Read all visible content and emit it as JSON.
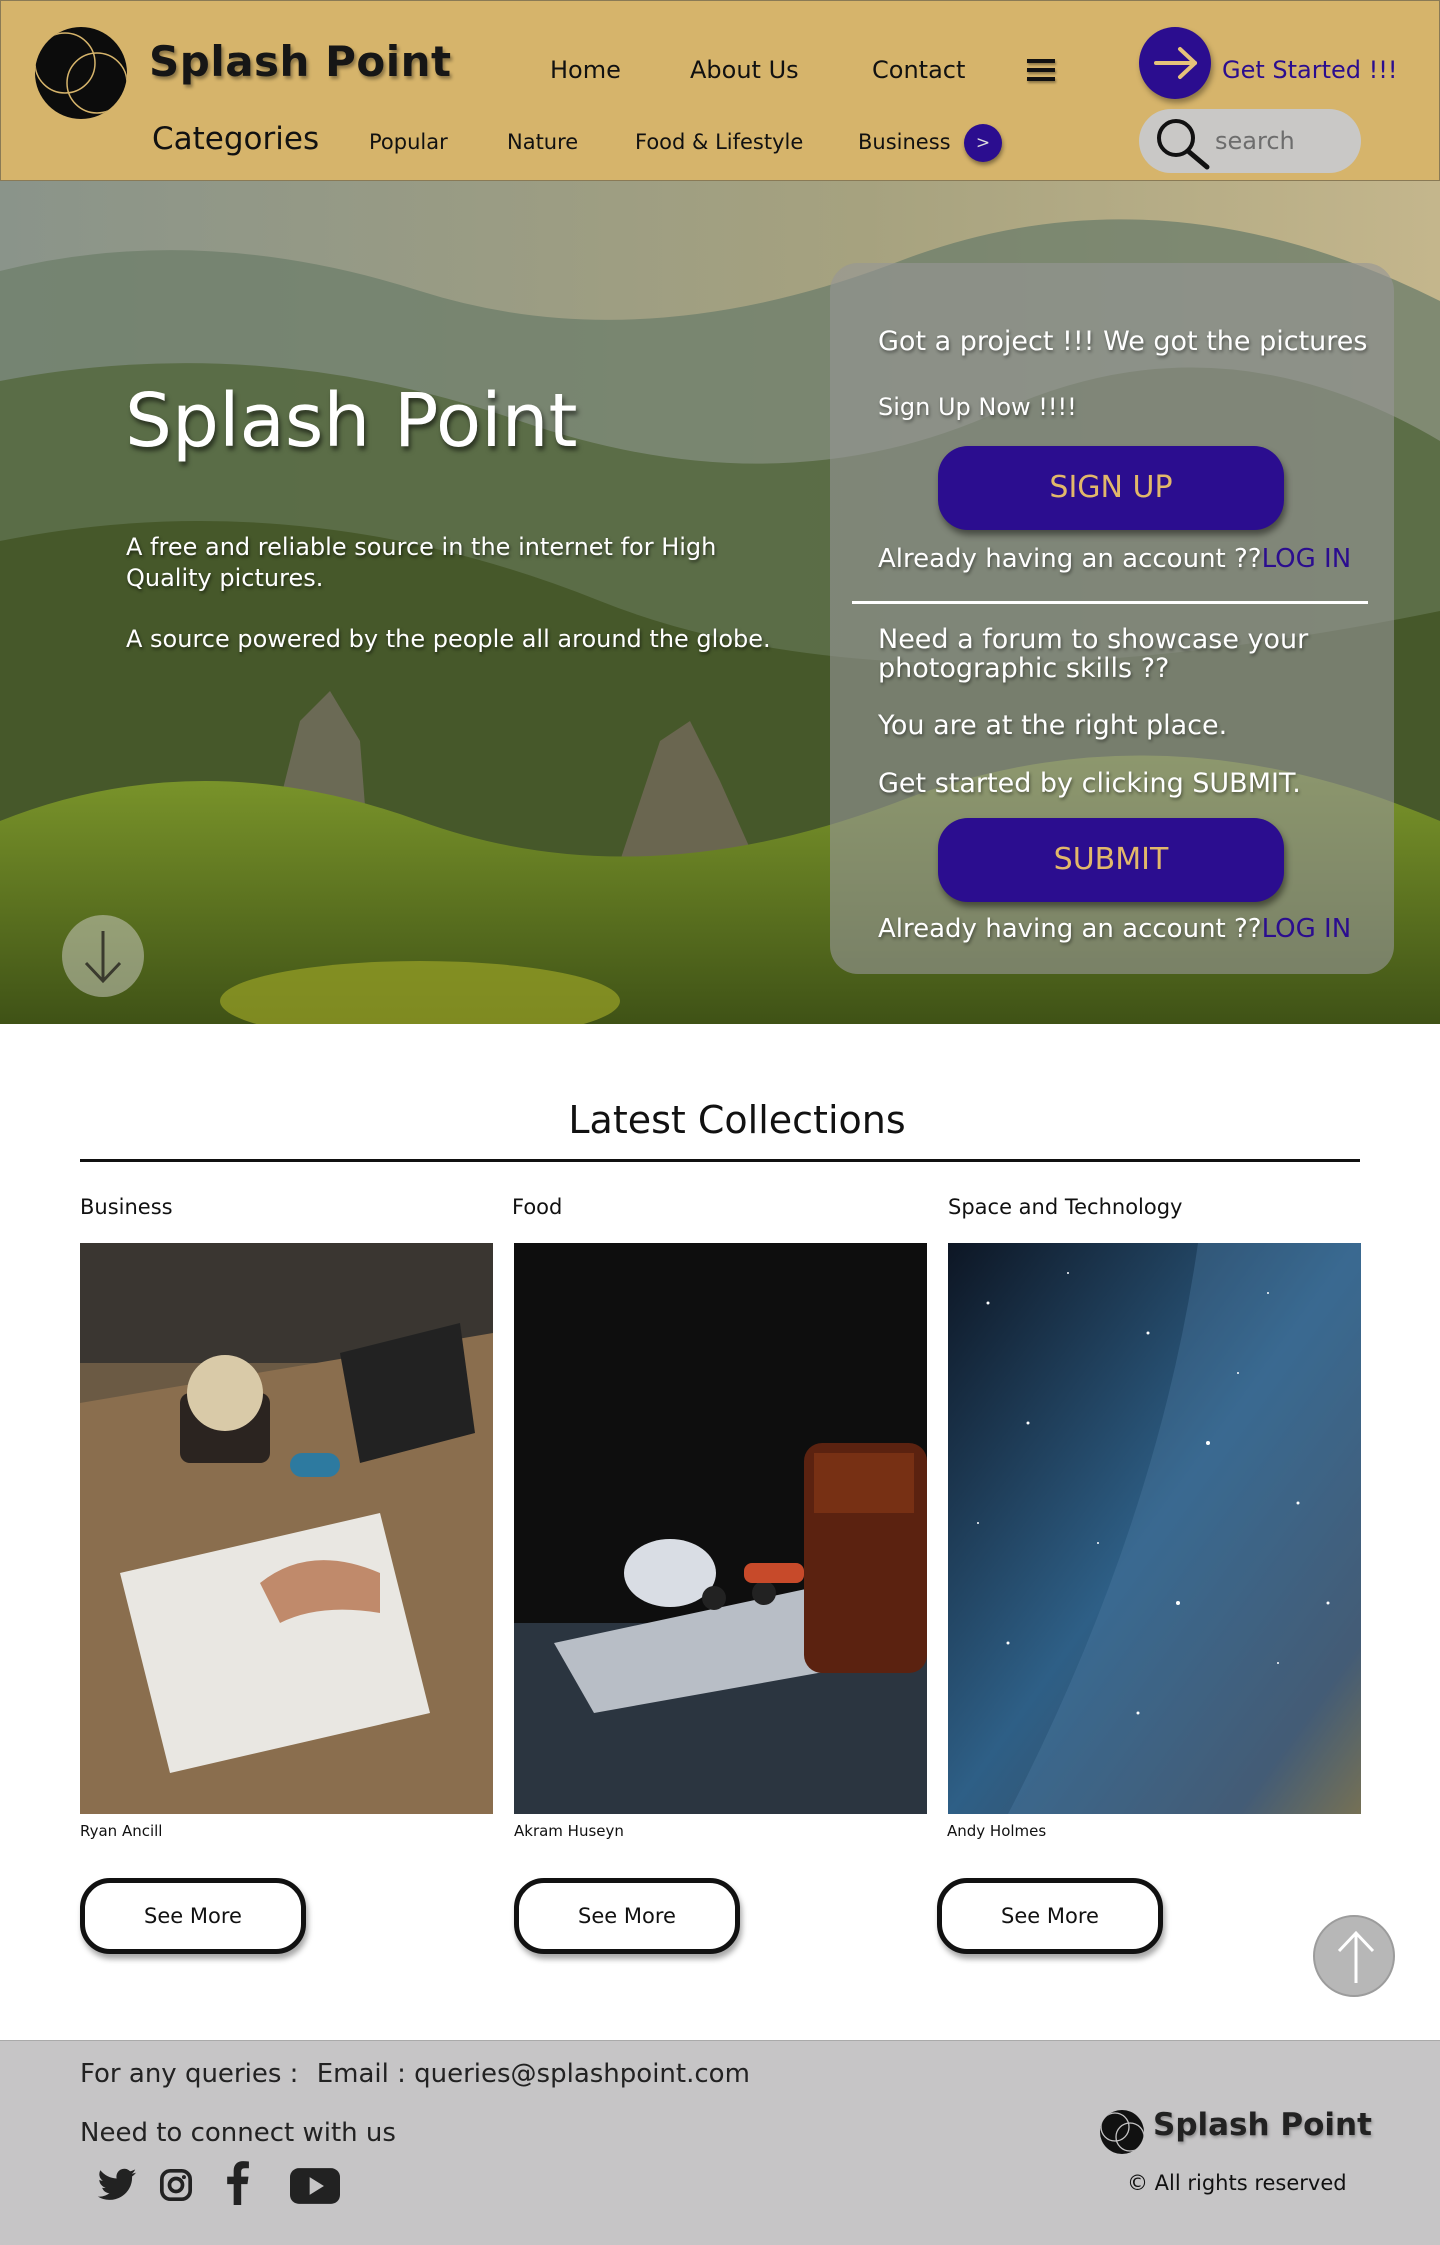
{
  "header": {
    "brand": "Splash Point",
    "nav": [
      "Home",
      "About Us",
      "Contact"
    ],
    "get_started": "Get Started !!!",
    "categories_label": "Categories",
    "categories": [
      "Popular",
      "Nature",
      "Food & Lifestyle",
      "Business"
    ],
    "categories_next": ">",
    "search_placeholder": "search"
  },
  "hero": {
    "title": "Splash Point",
    "line1": "A free and reliable source in the internet for High Quality pictures.",
    "line2": "A source powered by the people all around the globe."
  },
  "panel": {
    "signup_heading": "Got a project !!! We got the pictures",
    "signup_sub": "Sign Up Now !!!!",
    "signup_button": "SIGN UP",
    "account_q": "Already having an account ??",
    "login_label": "LOG IN",
    "forum_heading": "Need a forum to showcase your photographic skills ??",
    "forum_line1": "You are at the right place.",
    "forum_line2": "Get started by clicking SUBMIT.",
    "submit_button": "SUBMIT"
  },
  "collections": {
    "title": "Latest Collections",
    "items": [
      {
        "category": "Business",
        "credit": "Ryan Ancill",
        "button": "See More"
      },
      {
        "category": "Food",
        "credit": "Akram Huseyn",
        "button": "See More"
      },
      {
        "category": "Space and Technology",
        "credit": "Andy Holmes",
        "button": "See More"
      }
    ]
  },
  "footer": {
    "queries_prefix": "For any queries :",
    "email_label": "Email :",
    "email": "queries@splashpoint.com",
    "connect": "Need to connect with us",
    "social": [
      "twitter-icon",
      "instagram-icon",
      "facebook-icon",
      "youtube-icon"
    ],
    "brand": "Splash Point",
    "rights": "© All rights reserved"
  },
  "colors": {
    "header_bg": "#d6b46b",
    "accent": "#2b0d8f",
    "button_text": "#e2b86a",
    "footer_bg": "#c6c5c6"
  }
}
